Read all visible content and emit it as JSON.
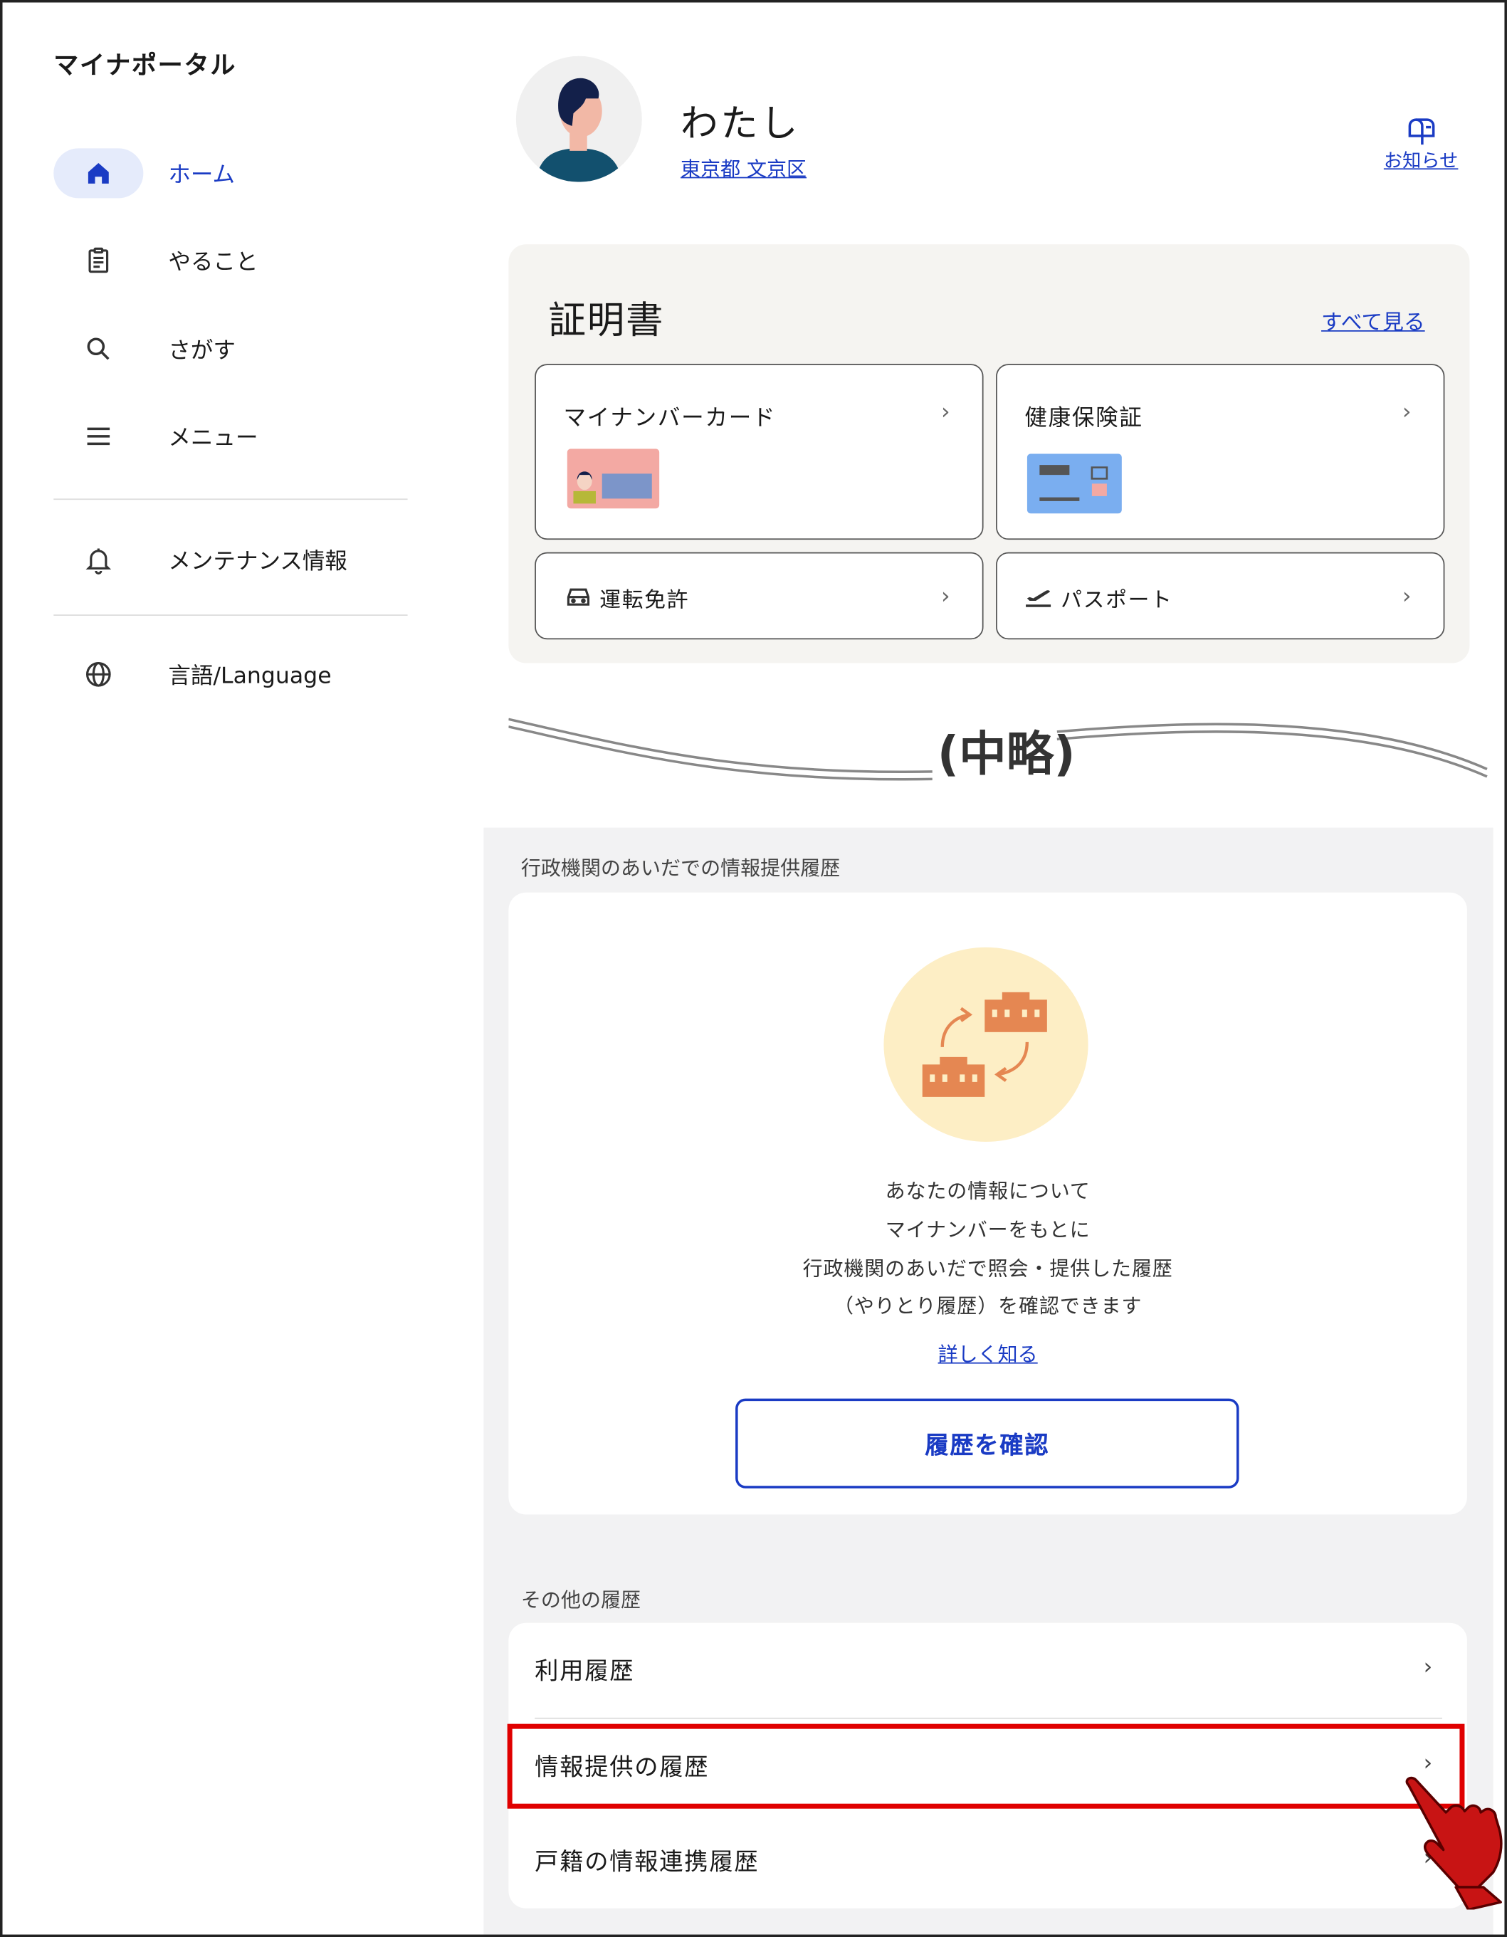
{
  "sidebar": {
    "app_title": "マイナポータル",
    "items": [
      {
        "label": "ホーム",
        "icon": "home-icon"
      },
      {
        "label": "やること",
        "icon": "clipboard-icon"
      },
      {
        "label": "さがす",
        "icon": "search-icon"
      },
      {
        "label": "メニュー",
        "icon": "menu-icon"
      },
      {
        "label": "メンテナンス情報",
        "icon": "bell-icon"
      },
      {
        "label": "言語/Language",
        "icon": "globe-icon"
      }
    ]
  },
  "profile": {
    "name": "わたし",
    "location": "東京都 文京区"
  },
  "header": {
    "notifications_label": "お知らせ"
  },
  "certificates": {
    "title": "証明書",
    "see_all": "すべて見る",
    "cards": [
      {
        "label": "マイナンバーカード"
      },
      {
        "label": "健康保険証"
      },
      {
        "label": "運転免許"
      },
      {
        "label": "パスポート"
      }
    ]
  },
  "omission_label": "(中略)",
  "info_provision": {
    "section_label": "行政機関のあいだでの情報提供履歴",
    "description_lines": [
      "あなたの情報について",
      "マイナンバーをもとに",
      "行政機関のあいだで照会・提供した履歴",
      "（やりとり履歴）を確認できます"
    ],
    "learn_more": "詳しく知る",
    "button_label": "履歴を確認"
  },
  "other_history": {
    "section_label": "その他の履歴",
    "items": [
      {
        "label": "利用履歴"
      },
      {
        "label": "情報提供の履歴"
      },
      {
        "label": "戸籍の情報連携履歴"
      }
    ]
  },
  "colors": {
    "accent": "#1a3bc4",
    "highlight": "#e00000",
    "active_nav_bg": "#e5ebfb",
    "panel_bg": "#f5f4f1",
    "section_bg": "#f2f2f3"
  }
}
